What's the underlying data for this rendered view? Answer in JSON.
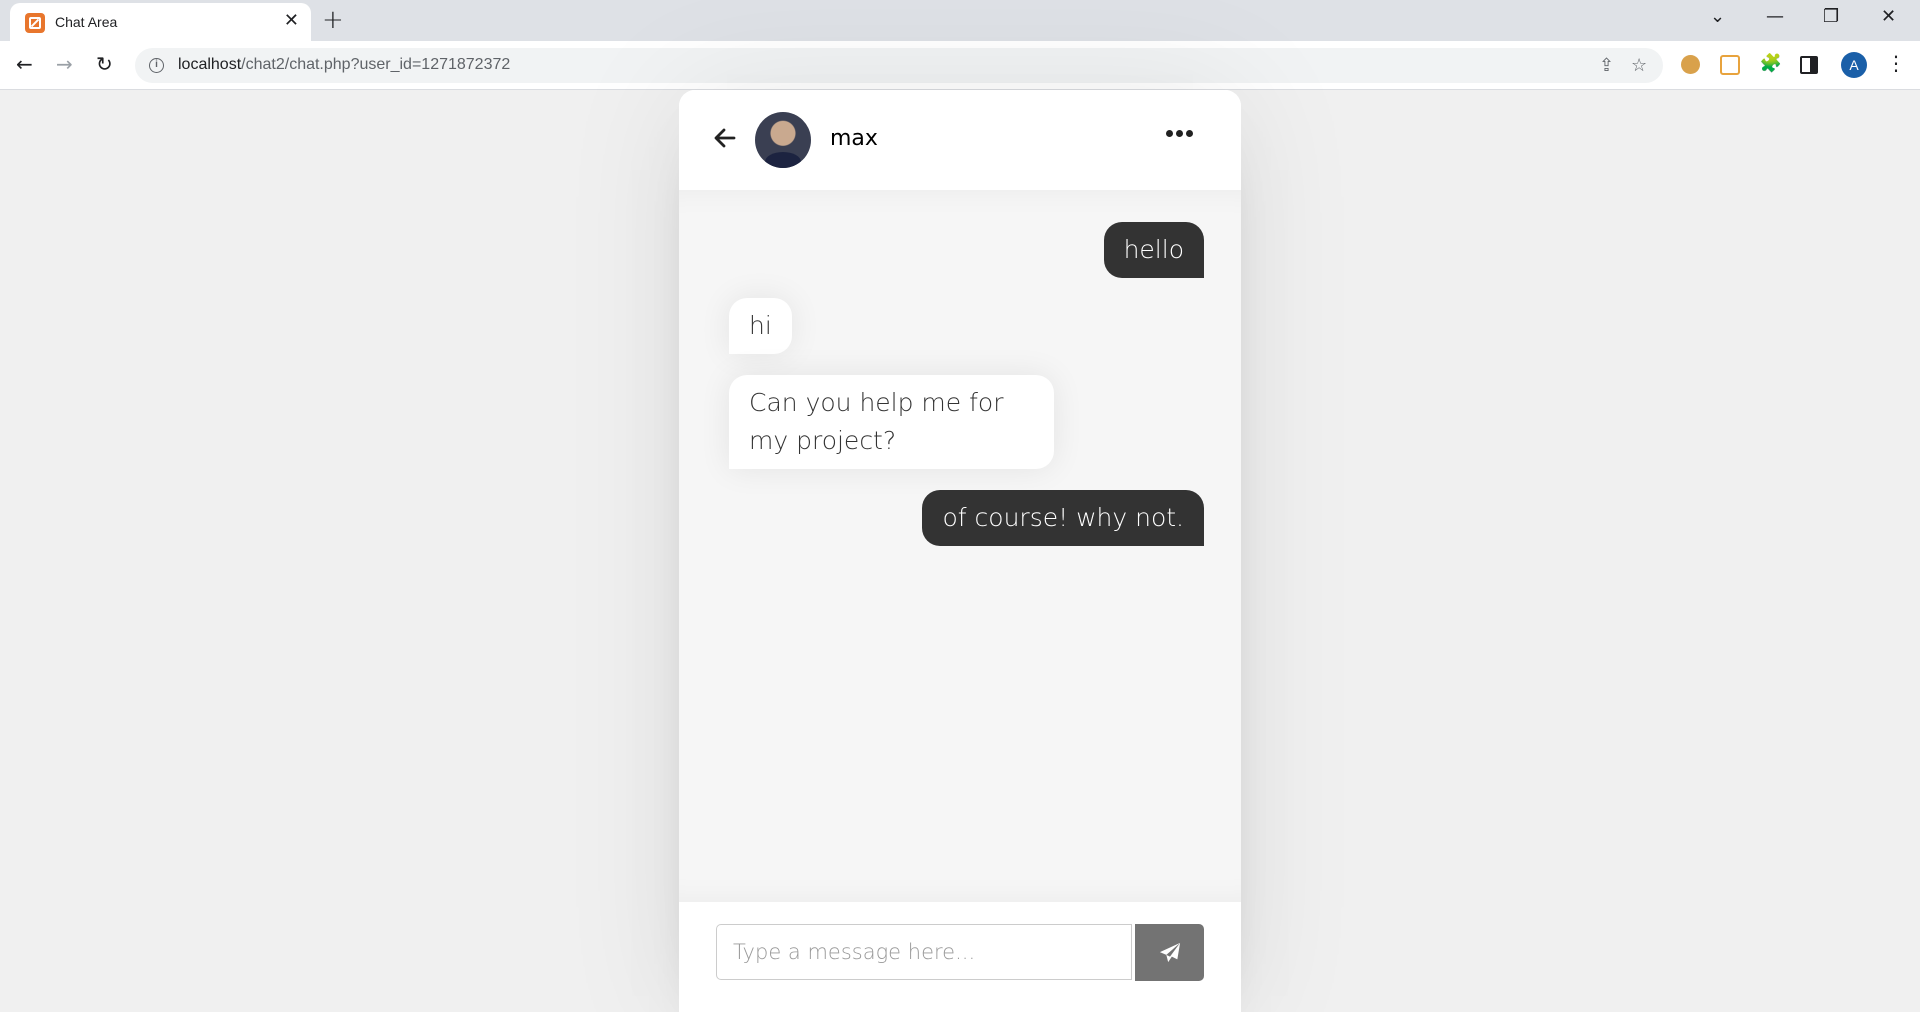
{
  "browser": {
    "tab": {
      "title": "Chat Area",
      "close_glyph": "✕",
      "favicon": "xampp-icon"
    },
    "new_tab_glyph": "+",
    "window": {
      "dropdown_glyph": "⌄",
      "minimize_glyph": "—",
      "restore_glyph": "❐",
      "close_glyph": "✕"
    },
    "nav": {
      "back_glyph": "←",
      "forward_glyph": "→",
      "reload_glyph": "↻"
    },
    "url": {
      "host": "localhost",
      "path": "/chat2/chat.php?user_id=1271872372"
    },
    "omnibox_icons": {
      "share": "share-icon",
      "bookmark": "star-icon",
      "bookmark_glyph": "☆",
      "share_glyph": "⇪"
    },
    "extensions": [
      "cookie-icon",
      "frame-icon",
      "puzzle-icon",
      "sidebar-icon"
    ],
    "puzzle_glyph": "🧩",
    "profile_initial": "A",
    "menu_glyph": "⋮"
  },
  "chat": {
    "header": {
      "username": "max"
    },
    "messages": [
      {
        "direction": "outgoing",
        "text": "hello"
      },
      {
        "direction": "incoming",
        "text": "hi"
      },
      {
        "direction": "incoming",
        "text": "Can you help me for my project?"
      },
      {
        "direction": "outgoing",
        "text": "of course! why not."
      }
    ],
    "input": {
      "placeholder": "Type a message here...",
      "value": ""
    }
  },
  "colors": {
    "outgoing_bubble": "#333333",
    "incoming_bubble": "#ffffff",
    "send_button": "#737373",
    "page_background": "#f0f0f0"
  }
}
